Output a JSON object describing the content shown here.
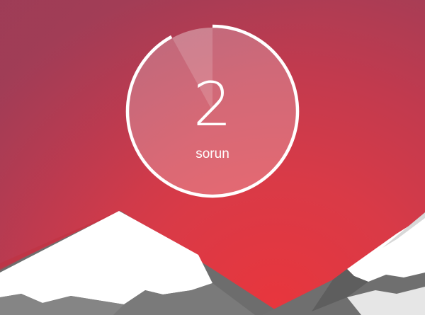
{
  "status": {
    "issue_count": "2",
    "issue_label": "sorun",
    "ring_progress": 0.92
  },
  "colors": {
    "background_center": "#e8363d",
    "background_edge": "#a83d55",
    "ring": "#ffffff",
    "mountain_snow": "#ffffff",
    "mountain_rock": "#777777"
  },
  "decor": {
    "illustration": "snowy-mountains"
  }
}
